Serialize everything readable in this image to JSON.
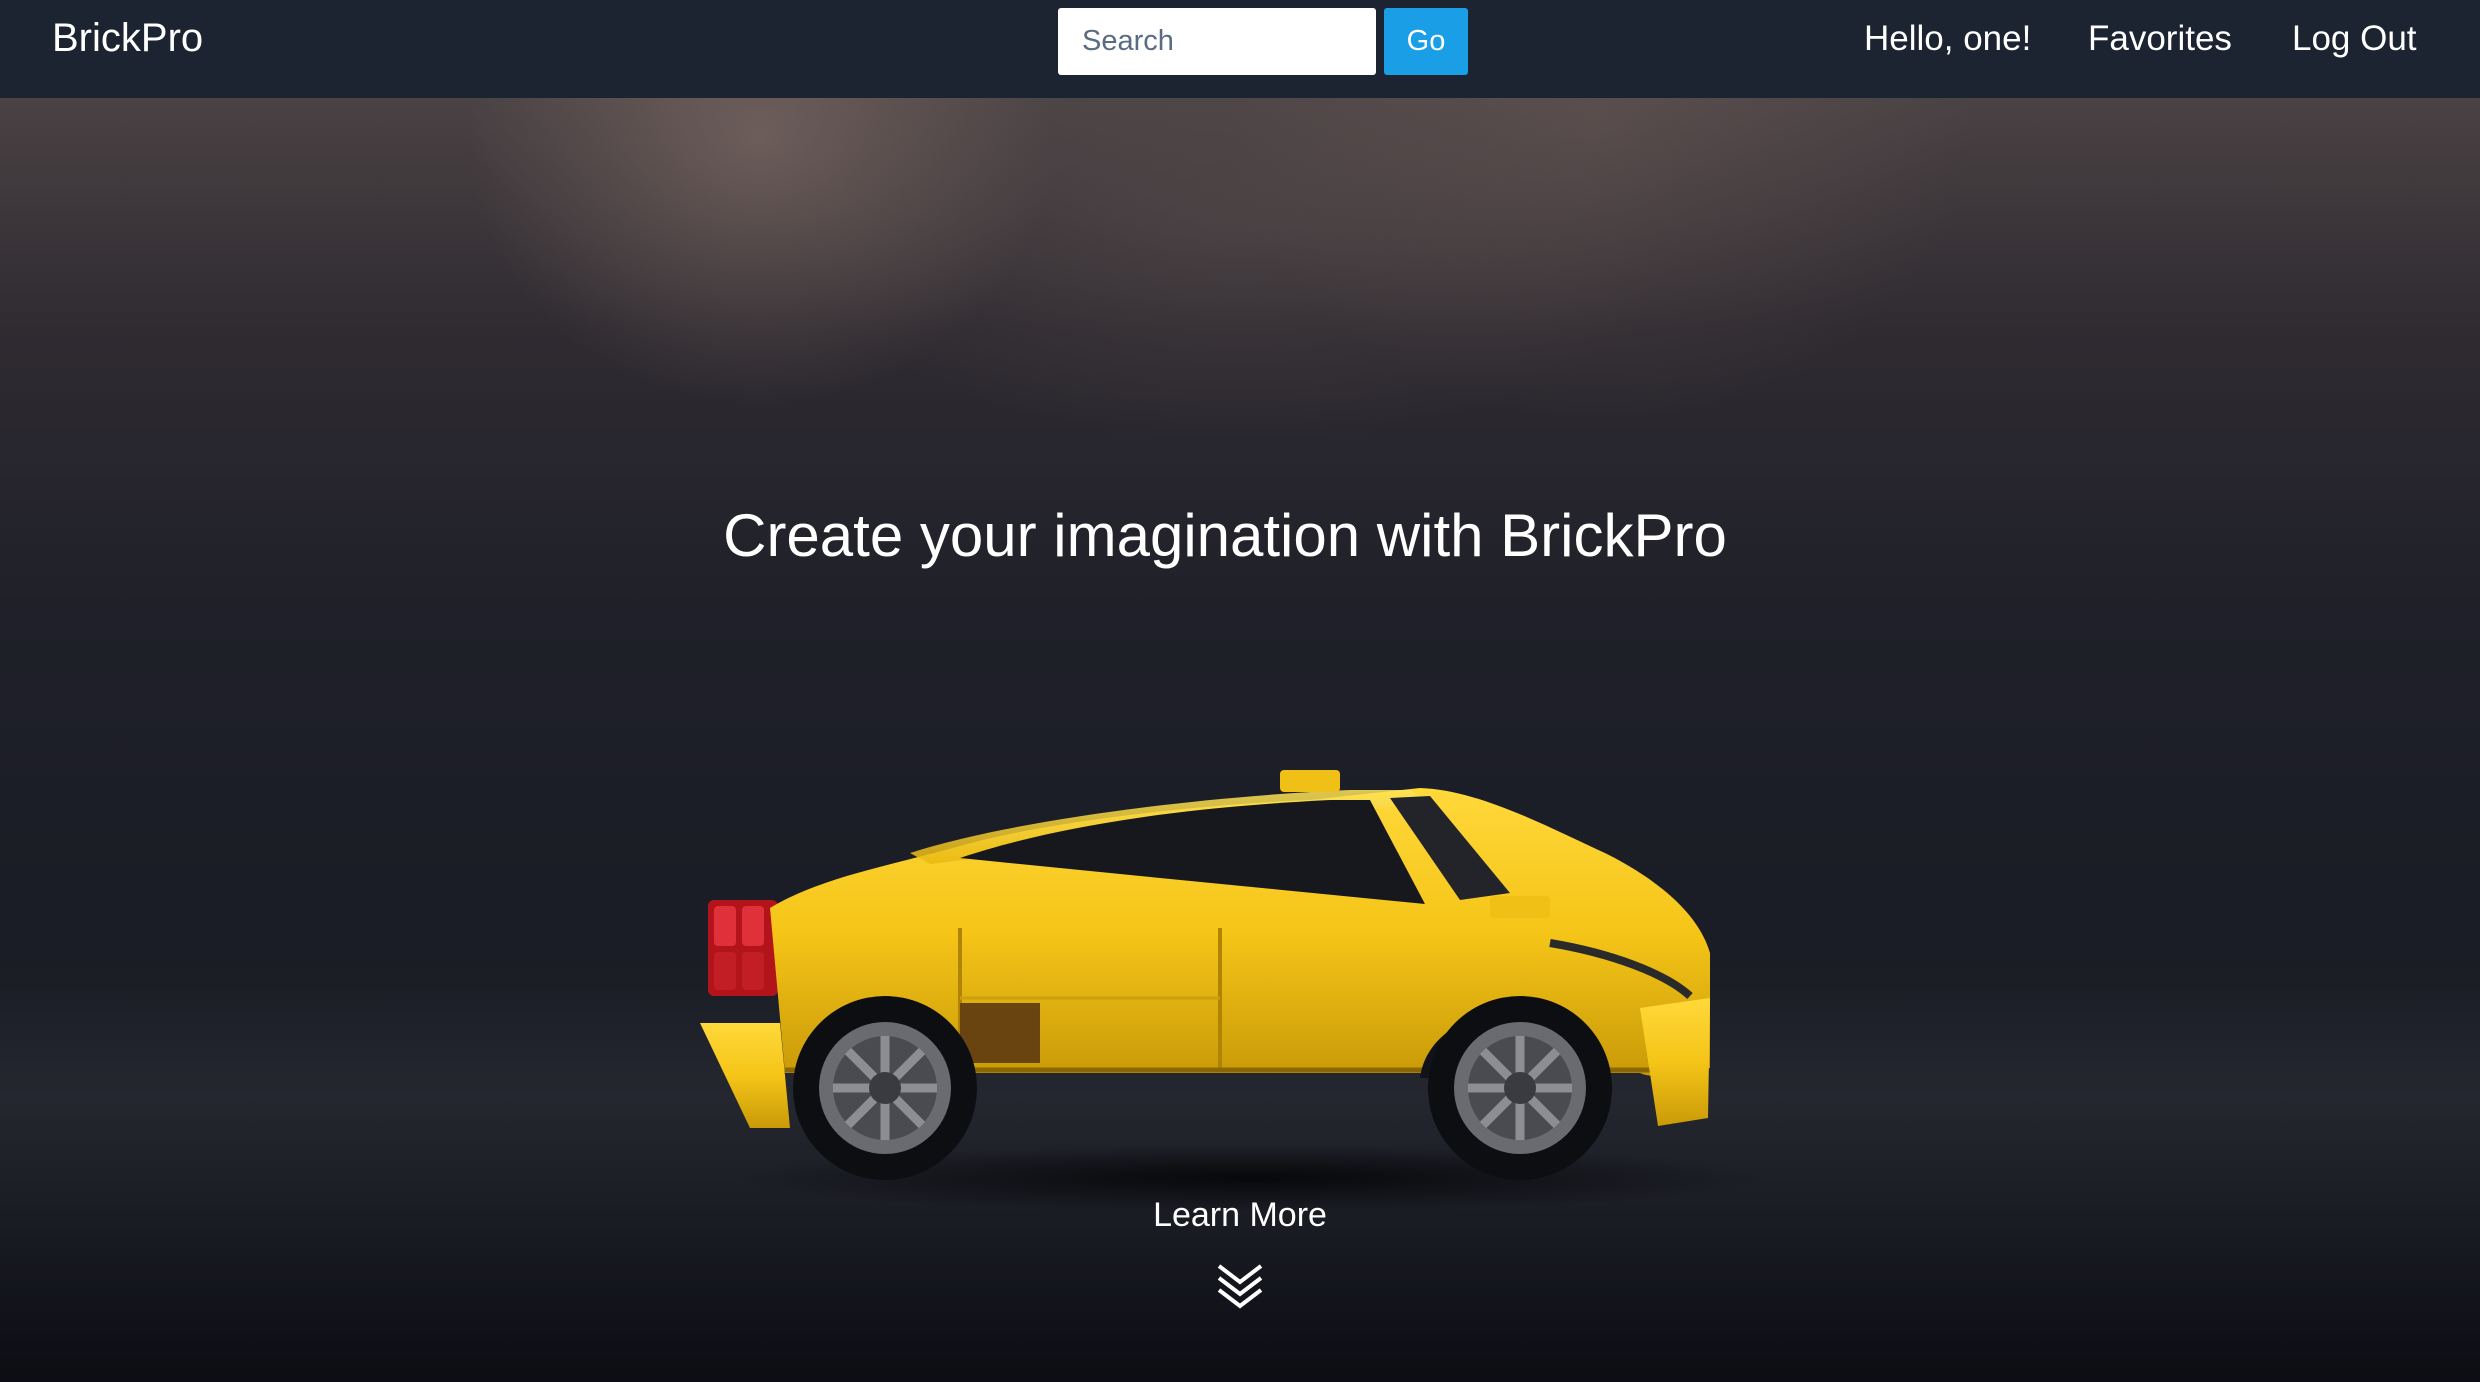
{
  "navbar": {
    "brand": "BrickPro",
    "search": {
      "placeholder": "Search",
      "value": ""
    },
    "go_label": "Go",
    "links": [
      {
        "label": "Hello, one!"
      },
      {
        "label": "Favorites"
      },
      {
        "label": "Log Out"
      }
    ]
  },
  "hero": {
    "title": "Create your imagination with BrickPro",
    "learn_more_label": "Learn More",
    "scroll_icon": "double-chevron-down-icon",
    "image_subject": "yellow-brick-sports-car"
  },
  "colors": {
    "navbar_bg": "#1c2331",
    "go_button": "#1a9fe6",
    "car_yellow": "#f5c518",
    "text": "#ffffff"
  }
}
